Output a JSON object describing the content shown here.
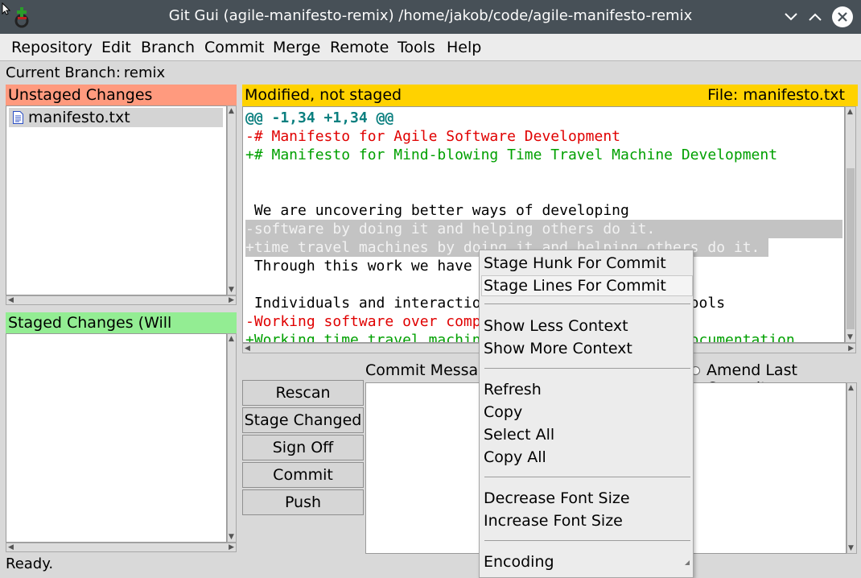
{
  "window": {
    "title": "Git Gui (agile-manifesto-remix) /home/jakob/code/agile-manifesto-remix"
  },
  "menu": [
    "Repository",
    "Edit",
    "Branch",
    "Commit",
    "Merge",
    "Remote",
    "Tools",
    "Help"
  ],
  "branch": {
    "label": "Current Branch:",
    "name": "remix"
  },
  "unstaged": {
    "title": "Unstaged Changes",
    "files": [
      "manifesto.txt"
    ]
  },
  "staged": {
    "title": "Staged Changes (Will Commit)"
  },
  "diff": {
    "status": "Modified, not staged",
    "file_label": "File: manifesto.txt",
    "lines": [
      {
        "type": "hunk",
        "text": "@@ -1,34 +1,34 @@"
      },
      {
        "type": "del",
        "text": "-# Manifesto for Agile Software Development"
      },
      {
        "type": "add",
        "text": "+# Manifesto for Mind-blowing Time Travel Machine Development"
      },
      {
        "type": "ctx",
        "text": ""
      },
      {
        "type": "ctx",
        "text": ""
      },
      {
        "type": "ctx",
        "text": " We are uncovering better ways of developing"
      },
      {
        "type": "sel",
        "text": "-software by doing it and helping others do it."
      },
      {
        "type": "sel",
        "text": "+time travel machines by doing it and helping others do it."
      },
      {
        "type": "ctx",
        "text": " Through this work we have"
      },
      {
        "type": "ctx",
        "text": ""
      },
      {
        "type": "ctx",
        "text": " Individuals and interactio                        ools"
      },
      {
        "type": "del",
        "text": "-Working software over comp"
      },
      {
        "type": "add",
        "text": "+Working time travel machin                        ocumentation"
      }
    ]
  },
  "commit": {
    "message_label": "Commit Message:",
    "amend_label": "Amend Last Commit"
  },
  "buttons": [
    "Rescan",
    "Stage Changed",
    "Sign Off",
    "Commit",
    "Push"
  ],
  "status_bar": "Ready.",
  "context_menu": {
    "items": [
      "Stage Hunk For Commit",
      "Stage Lines For Commit",
      "Show Less Context",
      "Show More Context",
      "Refresh",
      "Copy",
      "Select All",
      "Copy All",
      "Decrease Font Size",
      "Increase Font Size",
      "Encoding"
    ]
  },
  "colors": {
    "unstaged_header": "#ff9a7e",
    "staged_header": "#93ed93",
    "diff_header": "#ffd200",
    "hunk": "#0a7f7f",
    "deleted": "#e00000",
    "added": "#00a000"
  }
}
